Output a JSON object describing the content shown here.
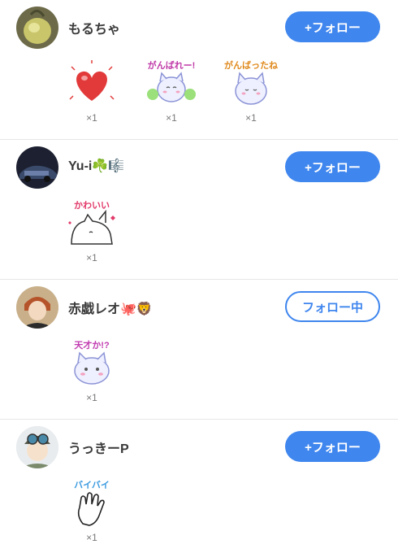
{
  "users": [
    {
      "name": "もるちゃ",
      "follow_label": "+フォロー",
      "following": false,
      "stickers": [
        {
          "caption": "",
          "icon": "heart-sticker",
          "count": "×1"
        },
        {
          "caption": "がんばれー!",
          "icon": "cheer-cat-sticker",
          "count": "×1"
        },
        {
          "caption": "がんばったね",
          "icon": "cat-sticker",
          "count": "×1"
        }
      ]
    },
    {
      "name": "Yu-i☘️🎼",
      "follow_label": "+フォロー",
      "following": false,
      "stickers": [
        {
          "caption": "かわいい",
          "icon": "cute-cat-sticker",
          "count": "×1"
        }
      ]
    },
    {
      "name": "赤戯レオ🐙🦁",
      "follow_label": "フォロー中",
      "following": true,
      "stickers": [
        {
          "caption": "天才か!?",
          "icon": "genius-cat-sticker",
          "count": "×1"
        }
      ]
    },
    {
      "name": "うっきーP",
      "follow_label": "+フォロー",
      "following": false,
      "stickers": [
        {
          "caption": "バイバイ",
          "icon": "wave-hand-sticker",
          "count": "×1"
        }
      ]
    }
  ],
  "colors": {
    "accent": "#3f86ee",
    "heart": "#e23a3a",
    "cat_outline": "#8b93d6"
  }
}
